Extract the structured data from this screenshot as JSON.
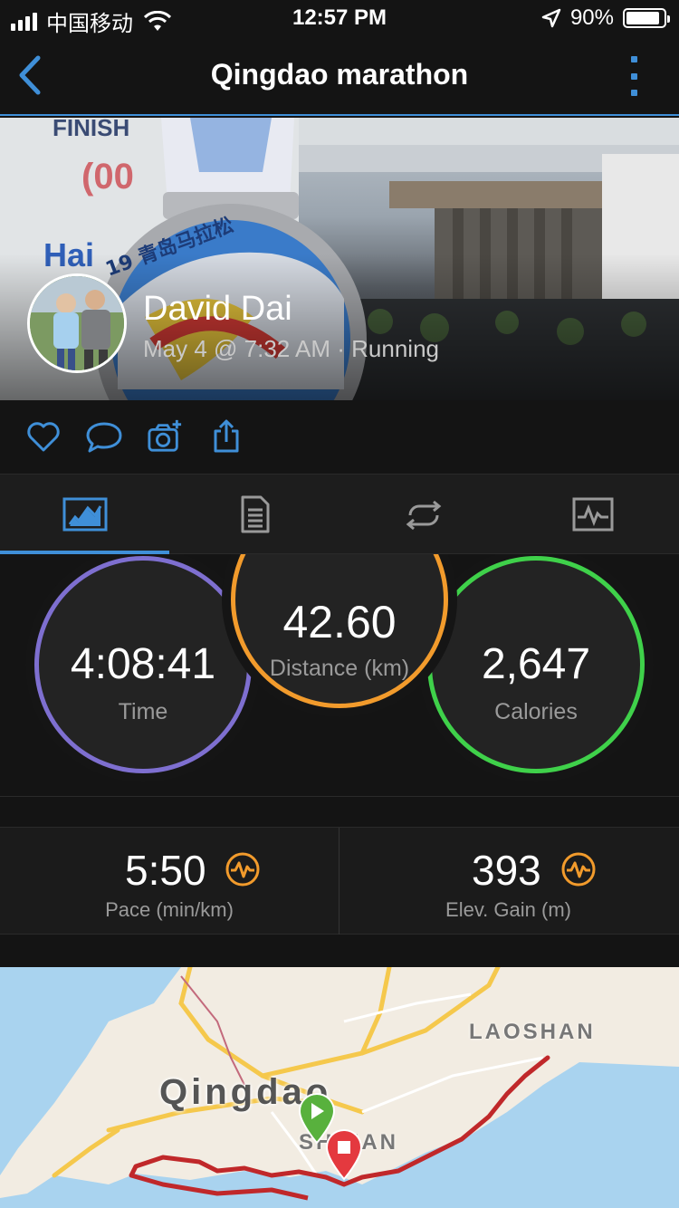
{
  "status_bar": {
    "carrier": "中国移动",
    "time": "12:57 PM",
    "battery_percent": "90%",
    "battery_level": 0.9
  },
  "nav": {
    "title": "Qingdao  marathon",
    "back_icon": "chevron-left-icon",
    "more_icon": "more-vertical-icon"
  },
  "header": {
    "user_name": "David Dai",
    "activity_meta": "May 4 @ 7:32 AM · Running"
  },
  "social": [
    "like-icon",
    "comment-icon",
    "add-photo-icon",
    "share-icon"
  ],
  "tabs": [
    {
      "name": "overview",
      "icon": "overview-icon",
      "active": true
    },
    {
      "name": "details",
      "icon": "document-icon",
      "active": false
    },
    {
      "name": "laps",
      "icon": "laps-icon",
      "active": false
    },
    {
      "name": "charts",
      "icon": "chart-icon",
      "active": false
    }
  ],
  "stats": {
    "time": {
      "value": "4:08:41",
      "label": "Time"
    },
    "distance": {
      "value": "42.60",
      "label": "Distance (km)"
    },
    "calories": {
      "value": "2,647",
      "label": "Calories"
    }
  },
  "metrics": {
    "pace": {
      "value": "5:50",
      "label": "Pace (min/km)"
    },
    "elevation": {
      "value": "393",
      "label": "Elev. Gain (m)"
    }
  },
  "map": {
    "city_label": "Qingdao",
    "district_label_1": "LAOSHAN",
    "district_label_2": "SHINAN"
  },
  "colors": {
    "accent": "#3f8fd8",
    "time_ring": "#7e6fd0",
    "distance_ring": "#f29b2c",
    "calories_ring": "#3fd14a",
    "route": "#c0282a",
    "start_pin": "#58b13d",
    "end_pin": "#e4393f"
  }
}
